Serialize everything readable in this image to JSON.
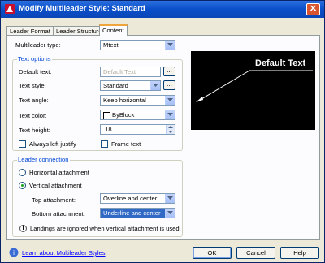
{
  "window": {
    "title": "Modify Multileader Style: Standard",
    "close_glyph": "✕"
  },
  "tabs": [
    {
      "label": "Leader Format"
    },
    {
      "label": "Leader Structure"
    },
    {
      "label": "Content"
    }
  ],
  "content": {
    "multileader_type": {
      "label": "Multileader type:",
      "value": "Mtext"
    },
    "text_options": {
      "title": "Text options",
      "default_text": {
        "label": "Default text:",
        "value": "Default Text",
        "browse_glyph": "..."
      },
      "text_style": {
        "label": "Text style:",
        "value": "Standard",
        "browse_glyph": "..."
      },
      "text_angle": {
        "label": "Text angle:",
        "value": "Keep horizontal"
      },
      "text_color": {
        "label": "Text color:",
        "value": "ByBlock",
        "swatch": "#ffffff"
      },
      "text_height": {
        "label": "Text height:",
        "value": ".18"
      },
      "always_left_justify": {
        "label": "Always left justify",
        "checked": false
      },
      "frame_text": {
        "label": "Frame text",
        "checked": false
      }
    },
    "leader_connection": {
      "title": "Leader connection",
      "horizontal": {
        "label": "Horizontal attachment",
        "selected": false
      },
      "vertical": {
        "label": "Vertical attachment",
        "selected": true
      },
      "top_attachment": {
        "label": "Top attachment:",
        "value": "Overline and center"
      },
      "bottom_attachment": {
        "label": "Bottom attachment:",
        "value": "Underline and center"
      },
      "note": "Landings are ignored when vertical attachment is used."
    }
  },
  "preview": {
    "text": "Default Text",
    "background": "#000000",
    "foreground": "#ffffff"
  },
  "footer": {
    "help_link": "Learn about Multileader Styles",
    "ok": "OK",
    "cancel": "Cancel",
    "help": "Help"
  },
  "colors": {
    "title_bar": "#0a4fc9",
    "group_title": "#0046d5",
    "tab_highlight": "#f0a43c"
  }
}
